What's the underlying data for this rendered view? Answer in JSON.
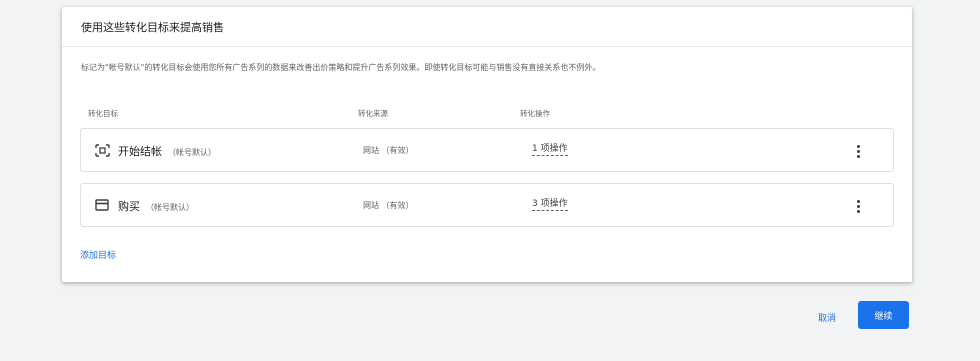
{
  "dialog": {
    "title": "使用这些转化目标来提高销售",
    "description": "标记为\"帐号默认\"的转化目标会使用您所有广告系列的数据来改善出价策略和提升广告系列效果。即使转化目标可能与销售没有直接关系也不例外。"
  },
  "table": {
    "headers": {
      "goal": "转化目标",
      "source": "转化来源",
      "actions": "转化操作"
    },
    "rows": [
      {
        "icon": "begin-checkout-icon",
        "name": "开始结帐",
        "tag": "（帐号默认）",
        "source": "网站 （有效）",
        "actions": "1 项操作"
      },
      {
        "icon": "purchase-card-icon",
        "name": "购买",
        "tag": "（帐号默认）",
        "source": "网站 （有效）",
        "actions": "3 项操作"
      }
    ]
  },
  "add_goal_label": "添加目标",
  "footer": {
    "cancel_label": "取消",
    "continue_label": "继续"
  },
  "colors": {
    "accent": "#1a73e8",
    "background": "#f1f3f4",
    "card": "#ffffff"
  }
}
